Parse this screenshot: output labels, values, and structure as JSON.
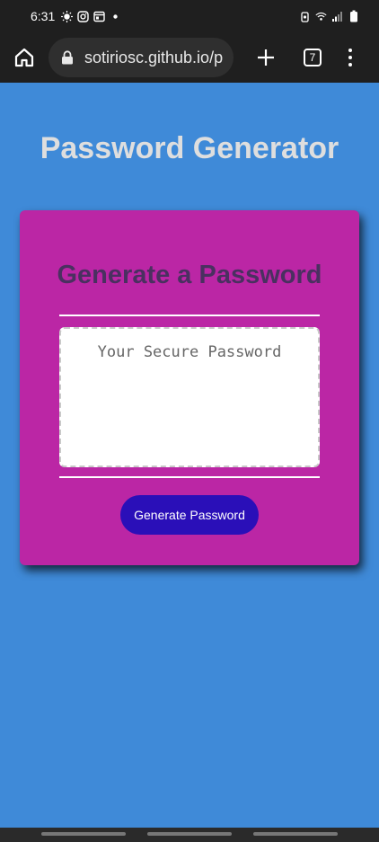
{
  "status_bar": {
    "time": "6:31",
    "icons": [
      "weather-icon",
      "instagram-icon",
      "news-icon",
      "dot-icon",
      "battery-saver-icon",
      "wifi-icon",
      "signal-icon",
      "battery-icon"
    ]
  },
  "browser": {
    "url": "sotiriosc.github.io/p",
    "tab_count": "7"
  },
  "page": {
    "title": "Password Generator",
    "card_title": "Generate a Password",
    "password_placeholder": "Your Secure Password",
    "password_value": "",
    "generate_button": "Generate Password"
  },
  "colors": {
    "background": "#3f8ad8",
    "card": "#bb26a5",
    "button": "#2a0fb8",
    "browser_chrome": "#1f1f1f"
  }
}
